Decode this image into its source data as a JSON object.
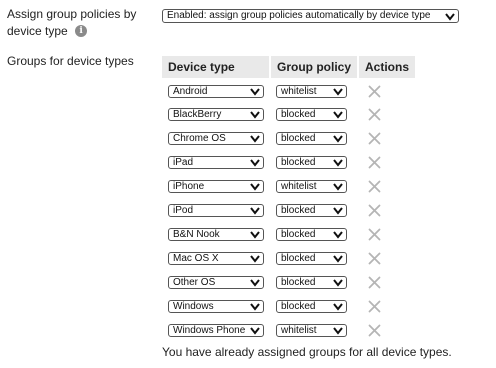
{
  "assign": {
    "label_line1": "Assign group policies by",
    "label_line2": "device type",
    "info_glyph": "i",
    "select_value": "Enabled: assign group policies automatically by device type"
  },
  "groups": {
    "label": "Groups for device types",
    "headers": {
      "device_type": "Device type",
      "group_policy": "Group policy",
      "actions": "Actions"
    },
    "rows": [
      {
        "device_type": "Android",
        "group_policy": "whitelist"
      },
      {
        "device_type": "BlackBerry",
        "group_policy": "blocked"
      },
      {
        "device_type": "Chrome OS",
        "group_policy": "blocked"
      },
      {
        "device_type": "iPad",
        "group_policy": "blocked"
      },
      {
        "device_type": "iPhone",
        "group_policy": "whitelist"
      },
      {
        "device_type": "iPod",
        "group_policy": "blocked"
      },
      {
        "device_type": "B&N Nook",
        "group_policy": "blocked"
      },
      {
        "device_type": "Mac OS X",
        "group_policy": "blocked"
      },
      {
        "device_type": "Other OS",
        "group_policy": "blocked"
      },
      {
        "device_type": "Windows",
        "group_policy": "blocked"
      },
      {
        "device_type": "Windows Phone",
        "group_policy": "whitelist"
      }
    ],
    "footer": "You have already assigned groups for all device types."
  },
  "icons": {
    "info": "info-icon",
    "dropdown": "chevron-down-icon",
    "remove": "close-icon"
  },
  "colors": {
    "header_bg": "#e9e9e9",
    "remove_icon": "#b5b5b5",
    "text": "#222222"
  }
}
